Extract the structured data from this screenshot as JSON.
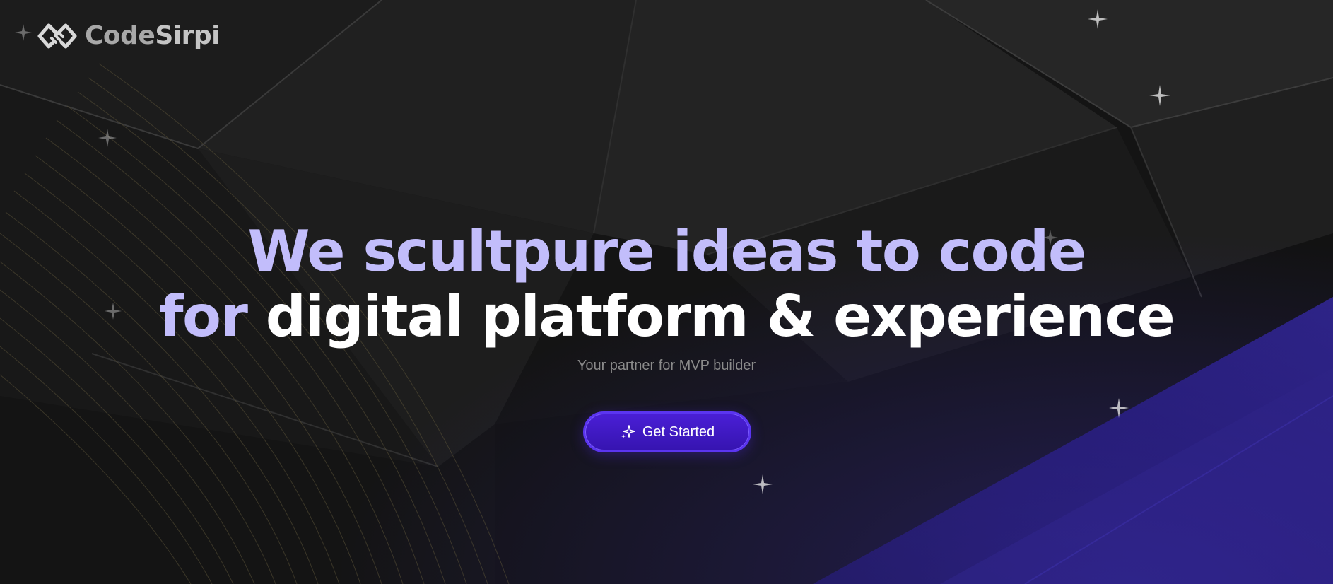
{
  "brand": {
    "name_part1": "Code",
    "name_part2": "Sirpi"
  },
  "hero": {
    "line1": "We scultpure ideas to code",
    "line2_accent": "for",
    "line2_main": "digital platform & experience",
    "subtitle": "Your partner for MVP builder"
  },
  "cta": {
    "label": "Get Started",
    "icon": "sparkle-icon"
  },
  "colors": {
    "background": "#151515",
    "headline_accent": "#c2bdfb",
    "headline_main": "#ffffff",
    "button": "#4a1fd6",
    "corner_gradient": "#2a1f7a"
  }
}
